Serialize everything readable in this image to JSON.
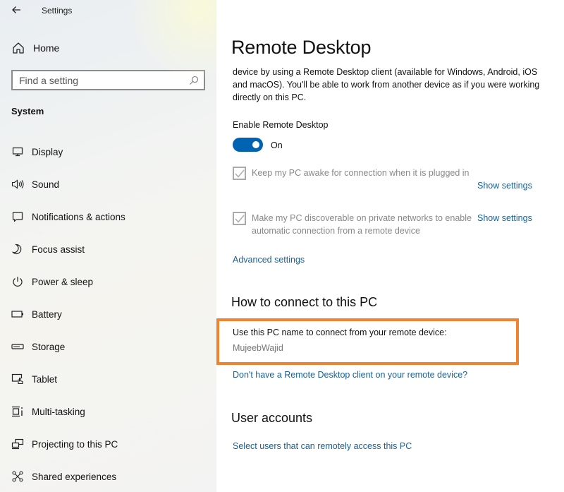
{
  "app": {
    "title": "Settings",
    "back_icon": "arrow-left-icon"
  },
  "sidebar": {
    "home": {
      "label": "Home",
      "icon": "home-icon"
    },
    "search": {
      "placeholder": "Find a setting",
      "value": "",
      "icon": "search-icon"
    },
    "section_label": "System",
    "items": [
      {
        "label": "Display",
        "icon": "monitor-icon"
      },
      {
        "label": "Sound",
        "icon": "speaker-icon"
      },
      {
        "label": "Notifications & actions",
        "icon": "notification-icon"
      },
      {
        "label": "Focus assist",
        "icon": "moon-icon"
      },
      {
        "label": "Power & sleep",
        "icon": "power-icon"
      },
      {
        "label": "Battery",
        "icon": "battery-icon"
      },
      {
        "label": "Storage",
        "icon": "storage-icon"
      },
      {
        "label": "Tablet",
        "icon": "tablet-icon"
      },
      {
        "label": "Multi-tasking",
        "icon": "multitasking-icon"
      },
      {
        "label": "Projecting to this PC",
        "icon": "projecting-icon"
      },
      {
        "label": "Shared experiences",
        "icon": "shared-experiences-icon"
      }
    ]
  },
  "main": {
    "title": "Remote Desktop",
    "description": "device by using a Remote Desktop client (available for Windows, Android, iOS and macOS). You'll be able to work from another device as if you were working directly on this PC.",
    "enable": {
      "label": "Enable Remote Desktop",
      "state_label": "On",
      "checked": true
    },
    "options": [
      {
        "label": "Keep my PC awake for connection when it is plugged in",
        "checked": true,
        "disabled": true,
        "link": "Show settings"
      },
      {
        "label": "Make my PC discoverable on private networks to enable automatic connection from a remote device",
        "checked": true,
        "disabled": true,
        "link": "Show settings"
      }
    ],
    "advanced_link": "Advanced settings",
    "connect": {
      "heading": "How to connect to this PC",
      "instruction": "Use this PC name to connect from your remote device:",
      "pc_name": "MujeebWajid",
      "highlight_color": "#f08330",
      "no_client_link": "Don't have a Remote Desktop client on your remote device?"
    },
    "user_accounts": {
      "heading": "User accounts",
      "link": "Select users that can remotely access this PC"
    }
  },
  "colors": {
    "accent": "#0063b1",
    "link": "#1a5f96",
    "highlight": "#f08330",
    "disabled_text": "#888888"
  }
}
